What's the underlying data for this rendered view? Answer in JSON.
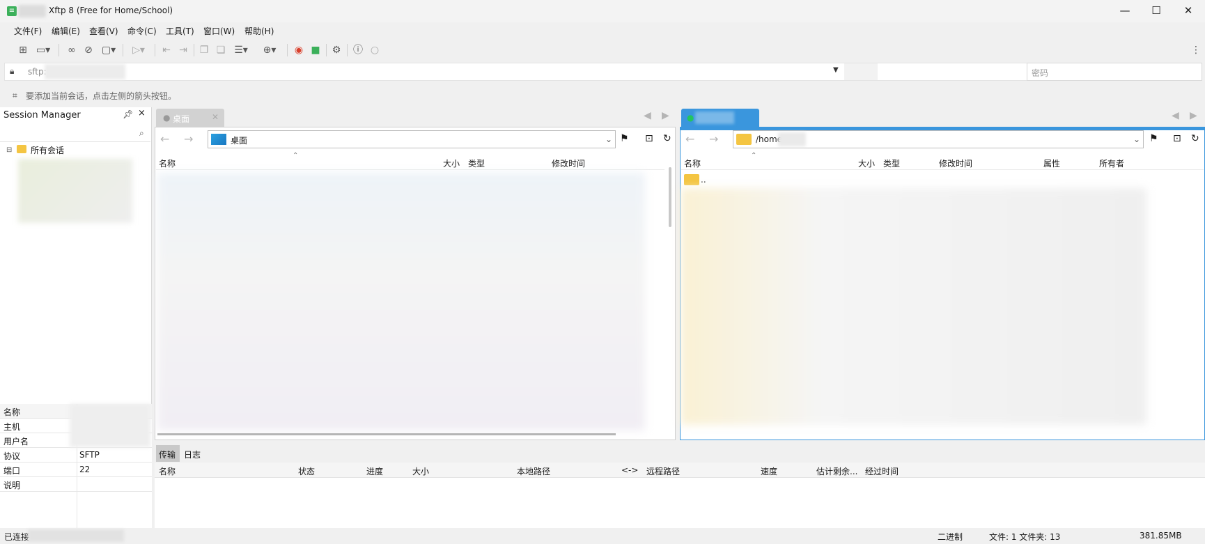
{
  "window": {
    "title": "Xftp 8 (Free for Home/School)",
    "minimize": "—",
    "maximize": "☐",
    "close": "✕"
  },
  "menu": [
    "文件(F)",
    "编辑(E)",
    "查看(V)",
    "命令(C)",
    "工具(T)",
    "窗口(W)",
    "帮助(H)"
  ],
  "address": {
    "prefix": "sftp:",
    "password_placeholder": "密码"
  },
  "hint": "要添加当前会话，点击左侧的箭头按钮。",
  "session_manager": {
    "title": "Session Manager",
    "tree_root": "所有会话",
    "properties": [
      {
        "key": "名称",
        "value": ""
      },
      {
        "key": "主机",
        "value": ""
      },
      {
        "key": "用户名",
        "value": ""
      },
      {
        "key": "协议",
        "value": "SFTP"
      },
      {
        "key": "端口",
        "value": "22"
      },
      {
        "key": "说明",
        "value": ""
      }
    ]
  },
  "local": {
    "tab": "桌面",
    "path": "桌面",
    "columns": [
      "名称",
      "大小",
      "类型",
      "修改时间"
    ]
  },
  "remote": {
    "path": "/home",
    "columns": [
      "名称",
      "大小",
      "类型",
      "修改时间",
      "属性",
      "所有者"
    ],
    "parent_entry": ".."
  },
  "transfer": {
    "tabs": [
      "传输",
      "日志"
    ],
    "columns": [
      "名称",
      "状态",
      "进度",
      "大小",
      "本地路径",
      "<->",
      "远程路径",
      "速度",
      "估计剩余...",
      "经过时间"
    ]
  },
  "status": {
    "connected": "已连接",
    "mode": "二进制",
    "counts": "文件: 1  文件夹: 13",
    "size": "381.85MB"
  }
}
